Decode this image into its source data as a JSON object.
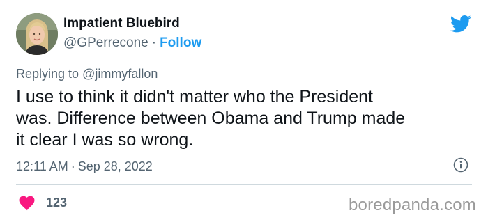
{
  "author": {
    "display_name": "Impatient Bluebird",
    "handle": "@GPerrecone",
    "separator": "·",
    "follow_label": "Follow",
    "avatar_icon": "profile-photo"
  },
  "reply": {
    "prefix": "Replying to",
    "mention": "@jimmyfallon"
  },
  "tweet": {
    "lines": [
      "I use to think it didn't matter who the President",
      "was. Difference between Obama and Trump made",
      "it clear I was so wrong."
    ]
  },
  "meta": {
    "time": "12:11 AM",
    "separator": "·",
    "date": "Sep 28, 2022",
    "info_icon": "info-icon"
  },
  "stats": {
    "likes": "123",
    "like_icon": "heart-icon"
  },
  "watermark": "boredpanda.com",
  "colors": {
    "accent": "#1d9bf0",
    "like": "#f91880",
    "text": "#0f1419",
    "muted": "#536471",
    "divider": "#cfd9de"
  }
}
